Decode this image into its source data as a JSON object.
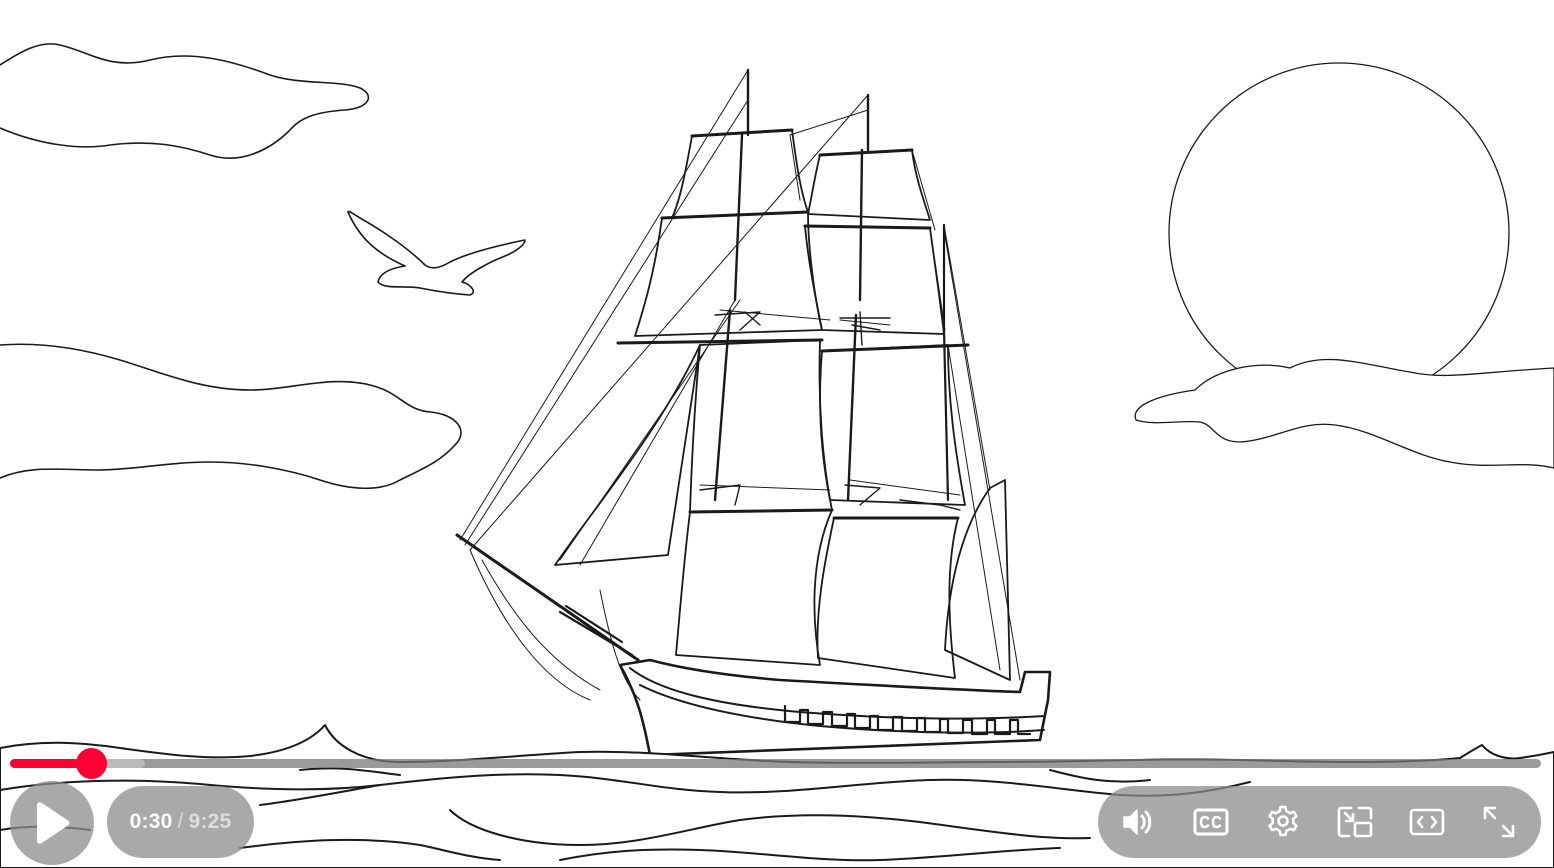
{
  "player": {
    "state": "paused",
    "current_time": "0:30",
    "time_separator": "/",
    "duration": "9:25",
    "progress": {
      "played_fraction": 0.053,
      "buffered_fraction": 0.088
    },
    "accent_color": "#ff0033",
    "control_bg_color": "#8c8c8c"
  },
  "controls": {
    "left": [
      {
        "name": "play-button",
        "icon": "play-icon"
      }
    ],
    "right": [
      {
        "name": "volume-button",
        "icon": "volume-icon"
      },
      {
        "name": "captions-button",
        "icon": "closed-captions-icon"
      },
      {
        "name": "settings-button",
        "icon": "gear-icon"
      },
      {
        "name": "miniplayer-button",
        "icon": "miniplayer-icon"
      },
      {
        "name": "theater-mode-button",
        "icon": "theater-mode-icon"
      },
      {
        "name": "fullscreen-button",
        "icon": "fullscreen-icon"
      }
    ]
  },
  "video_frame": {
    "description_icon": "ship-line-drawing"
  }
}
